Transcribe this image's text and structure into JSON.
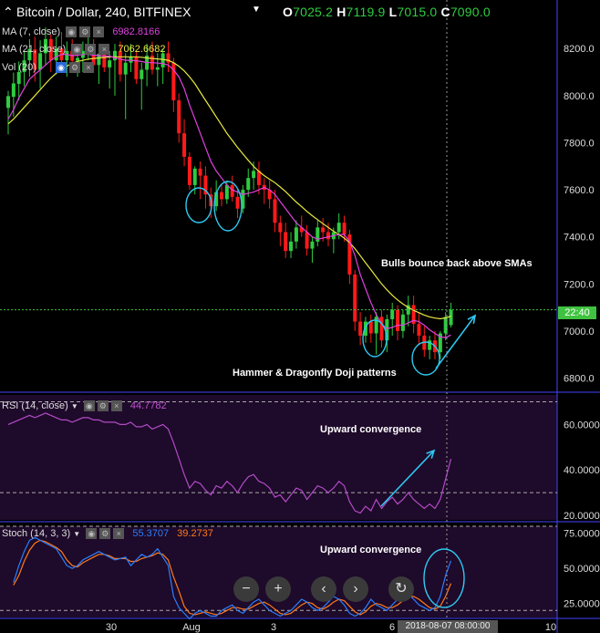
{
  "header": {
    "symbol": "Bitcoin / Dollar, 240, BITFINEX",
    "o_label": "O",
    "o": "7025.2",
    "h_label": "H",
    "h": "7119.9",
    "l_label": "L",
    "l": "7015.0",
    "c_label": "C",
    "c": "7090.0"
  },
  "legends": {
    "ma7_label": "MA (7, close)",
    "ma7_value": "6982.8166",
    "ma21_label": "MA (21, close)",
    "ma21_value": "7062.6682",
    "vol_label": "Vol (20)",
    "rsi_label": "RSI (14, close)",
    "rsi_value": "44.7782",
    "stoch_label": "Stoch (14, 3, 3)",
    "stoch_k": "55.3707",
    "stoch_d": "39.2737"
  },
  "annotations": {
    "bulls": "Bulls bounce back above SMAs",
    "patterns": "Hammer & Dragonfly Doji patterns",
    "rsi_conv": "Upward convergence",
    "stoch_conv": "Upward convergence"
  },
  "price_tag": "22:40",
  "crosshair_label": "2018-08-07 08:00:00",
  "colors": {
    "bull": "#2ecc40",
    "bear": "#ff1a1a",
    "ma7": "#e040e0",
    "ma21": "#e8e840",
    "rsi": "#b34bc8",
    "stoch_k": "#2a7fff",
    "stoch_d": "#ff7a1a",
    "arrow": "#2ec8f0",
    "panel": "#1e0a2a"
  },
  "chart_data": [
    {
      "type": "candlestick",
      "title": "Bitcoin / Dollar, 240, BITFINEX",
      "xlabel": "",
      "ylabel": "",
      "ylim": [
        6740,
        8290
      ],
      "y_ticks": [
        6800,
        7000,
        7200,
        7400,
        7600,
        7800,
        8000,
        8200
      ],
      "x_ticks": [
        "30",
        "Aug",
        "3",
        "6",
        "10"
      ],
      "candles": [
        [
          7948,
          8020,
          7835,
          7998
        ],
        [
          7995,
          8098,
          7910,
          8052
        ],
        [
          8050,
          8145,
          7980,
          8100
        ],
        [
          8100,
          8190,
          8040,
          8150
        ],
        [
          8150,
          8240,
          8080,
          8198
        ],
        [
          8196,
          8250,
          8060,
          8110
        ],
        [
          8110,
          8235,
          8030,
          8180
        ],
        [
          8180,
          8290,
          8130,
          8240
        ],
        [
          8240,
          8260,
          8100,
          8150
        ],
        [
          8150,
          8250,
          8090,
          8200
        ],
        [
          8200,
          8270,
          8120,
          8150
        ],
        [
          8150,
          8230,
          8080,
          8190
        ],
        [
          8190,
          8240,
          8120,
          8148
        ],
        [
          8148,
          8200,
          8080,
          8160
        ],
        [
          8160,
          8230,
          8100,
          8190
        ],
        [
          8190,
          8270,
          8150,
          8214
        ],
        [
          8214,
          8240,
          8100,
          8130
        ],
        [
          8130,
          8200,
          8050,
          8178
        ],
        [
          8178,
          8220,
          8100,
          8120
        ],
        [
          8120,
          8190,
          8030,
          8150
        ],
        [
          8150,
          8220,
          8000,
          8190
        ],
        [
          8190,
          8230,
          8060,
          8090
        ],
        [
          8090,
          8180,
          7900,
          8140
        ],
        [
          8140,
          8220,
          8100,
          8165
        ],
        [
          8165,
          8190,
          8050,
          8070
        ],
        [
          8070,
          8140,
          7940,
          8110
        ],
        [
          8110,
          8220,
          8040,
          8170
        ],
        [
          8170,
          8230,
          8090,
          8110
        ],
        [
          8110,
          8180,
          8040,
          8120
        ],
        [
          8120,
          8200,
          8050,
          8180
        ],
        [
          8180,
          8230,
          8100,
          8140
        ],
        [
          8140,
          8160,
          7930,
          7980
        ],
        [
          7980,
          8010,
          7800,
          7840
        ],
        [
          7840,
          7900,
          7700,
          7740
        ],
        [
          7740,
          7760,
          7600,
          7620
        ],
        [
          7620,
          7700,
          7580,
          7690
        ],
        [
          7690,
          7720,
          7560,
          7660
        ],
        [
          7660,
          7700,
          7520,
          7580
        ],
        [
          7580,
          7610,
          7480,
          7530
        ],
        [
          7530,
          7640,
          7510,
          7590
        ],
        [
          7590,
          7620,
          7530,
          7560
        ],
        [
          7560,
          7640,
          7540,
          7620
        ],
        [
          7620,
          7660,
          7550,
          7570
        ],
        [
          7570,
          7600,
          7480,
          7520
        ],
        [
          7520,
          7620,
          7500,
          7600
        ],
        [
          7600,
          7690,
          7570,
          7650
        ],
        [
          7650,
          7720,
          7600,
          7680
        ],
        [
          7680,
          7720,
          7580,
          7620
        ],
        [
          7620,
          7650,
          7540,
          7600
        ],
        [
          7600,
          7640,
          7520,
          7560
        ],
        [
          7560,
          7600,
          7420,
          7460
        ],
        [
          7460,
          7490,
          7360,
          7420
        ],
        [
          7420,
          7460,
          7310,
          7340
        ],
        [
          7340,
          7420,
          7310,
          7380
        ],
        [
          7380,
          7470,
          7350,
          7440
        ],
        [
          7440,
          7490,
          7400,
          7420
        ],
        [
          7420,
          7450,
          7320,
          7350
        ],
        [
          7350,
          7400,
          7290,
          7380
        ],
        [
          7380,
          7470,
          7360,
          7440
        ],
        [
          7440,
          7480,
          7380,
          7420
        ],
        [
          7420,
          7460,
          7360,
          7390
        ],
        [
          7390,
          7440,
          7330,
          7420
        ],
        [
          7420,
          7500,
          7390,
          7460
        ],
        [
          7460,
          7490,
          7380,
          7410
        ],
        [
          7410,
          7430,
          7200,
          7240
        ],
        [
          7240,
          7260,
          7000,
          7040
        ],
        [
          7040,
          7080,
          6940,
          6980
        ],
        [
          6980,
          7060,
          6950,
          7040
        ],
        [
          7040,
          7070,
          6950,
          6990
        ],
        [
          6990,
          7080,
          6900,
          7060
        ],
        [
          7060,
          7090,
          6930,
          6960
        ],
        [
          6960,
          7070,
          6910,
          7050
        ],
        [
          7050,
          7120,
          6980,
          7090
        ],
        [
          7090,
          7110,
          6960,
          7000
        ],
        [
          7000,
          7090,
          6970,
          7070
        ],
        [
          7070,
          7150,
          7020,
          7110
        ],
        [
          7110,
          7150,
          6990,
          7030
        ],
        [
          7030,
          7080,
          6940,
          6980
        ],
        [
          6980,
          7020,
          6890,
          6920
        ],
        [
          6920,
          6980,
          6880,
          6960
        ],
        [
          6960,
          7000,
          6880,
          6910
        ],
        [
          6910,
          7000,
          6880,
          6990
        ],
        [
          6990,
          7080,
          6960,
          7060
        ],
        [
          7025.2,
          7119.9,
          7015,
          7090
        ]
      ],
      "ma7": [
        7900,
        7940,
        7990,
        8030,
        8070,
        8090,
        8110,
        8130,
        8150,
        8165,
        8175,
        8175,
        8170,
        8172,
        8175,
        8175,
        8172,
        8170,
        8168,
        8168,
        8160,
        8155,
        8150,
        8150,
        8148,
        8145,
        8140,
        8140,
        8138,
        8136,
        8130,
        8110,
        8080,
        8030,
        7960,
        7900,
        7840,
        7780,
        7720,
        7680,
        7650,
        7620,
        7600,
        7590,
        7580,
        7585,
        7590,
        7600,
        7610,
        7600,
        7580,
        7550,
        7520,
        7490,
        7460,
        7440,
        7420,
        7400,
        7390,
        7395,
        7400,
        7405,
        7410,
        7410,
        7380,
        7320,
        7240,
        7180,
        7120,
        7070,
        7030,
        7010,
        7015,
        7025,
        7025,
        7035,
        7045,
        7040,
        7025,
        7005,
        6990,
        6975,
        6972,
        6982.8
      ],
      "ma21": [
        7880,
        7900,
        7925,
        7950,
        7975,
        8000,
        8025,
        8050,
        8075,
        8095,
        8110,
        8125,
        8138,
        8145,
        8150,
        8155,
        8158,
        8160,
        8162,
        8164,
        8165,
        8165,
        8165,
        8165,
        8165,
        8163,
        8160,
        8158,
        8156,
        8154,
        8150,
        8140,
        8125,
        8105,
        8080,
        8050,
        8015,
        7980,
        7945,
        7910,
        7875,
        7840,
        7810,
        7780,
        7752,
        7725,
        7700,
        7678,
        7660,
        7645,
        7630,
        7612,
        7592,
        7570,
        7548,
        7528,
        7508,
        7490,
        7473,
        7456,
        7440,
        7424,
        7410,
        7395,
        7375,
        7350,
        7320,
        7290,
        7260,
        7230,
        7200,
        7175,
        7152,
        7132,
        7115,
        7100,
        7088,
        7078,
        7068,
        7060,
        7055,
        7052,
        7056,
        7062.7
      ]
    },
    {
      "type": "line",
      "title": "RSI (14, close)",
      "ylim": [
        18,
        73
      ],
      "y_ticks": [
        20,
        40,
        60
      ],
      "series": [
        {
          "name": "RSI (14, close)",
          "values": [
            60,
            61,
            62,
            63,
            64,
            63,
            64,
            65,
            64,
            63,
            62,
            62,
            61,
            62,
            63,
            63,
            62,
            62,
            61,
            61,
            61,
            60,
            60,
            61,
            59,
            59,
            60,
            58,
            59,
            60,
            58,
            52,
            45,
            38,
            32,
            35,
            34,
            31,
            29,
            33,
            32,
            35,
            33,
            30,
            34,
            37,
            38,
            35,
            34,
            32,
            28,
            29,
            26,
            29,
            32,
            31,
            27,
            30,
            33,
            32,
            30,
            32,
            35,
            33,
            26,
            22,
            21,
            24,
            22,
            27,
            23,
            26,
            28,
            25,
            27,
            30,
            27,
            25,
            23,
            25,
            23,
            27,
            36,
            44.8
          ]
        }
      ]
    },
    {
      "type": "line",
      "title": "Stoch (14, 3, 3)",
      "ylim": [
        15,
        80
      ],
      "y_ticks": [
        25,
        50,
        75
      ],
      "series": [
        {
          "name": "K",
          "values": [
            40,
            52,
            62,
            70,
            72,
            70,
            68,
            66,
            64,
            58,
            52,
            50,
            52,
            56,
            58,
            60,
            62,
            60,
            58,
            56,
            57,
            58,
            52,
            56,
            60,
            58,
            60,
            64,
            58,
            52,
            30,
            22,
            18,
            14,
            18,
            20,
            18,
            16,
            16,
            20,
            22,
            24,
            20,
            18,
            22,
            26,
            28,
            24,
            20,
            18,
            16,
            18,
            20,
            24,
            28,
            26,
            22,
            20,
            22,
            26,
            30,
            28,
            24,
            18,
            16,
            18,
            22,
            28,
            24,
            22,
            20,
            24,
            28,
            30,
            32,
            28,
            24,
            22,
            20,
            22,
            30,
            45,
            55.4
          ]
        },
        {
          "name": "D",
          "values": [
            38,
            45,
            55,
            63,
            68,
            70,
            69,
            67,
            65,
            62,
            56,
            52,
            51,
            54,
            56,
            58,
            60,
            60,
            59,
            57,
            57,
            57,
            55,
            55,
            57,
            58,
            59,
            61,
            60,
            56,
            44,
            34,
            23,
            18,
            17,
            18,
            19,
            18,
            17,
            18,
            20,
            22,
            22,
            21,
            21,
            23,
            25,
            26,
            24,
            21,
            18,
            17,
            18,
            21,
            24,
            26,
            25,
            22,
            21,
            23,
            26,
            28,
            27,
            23,
            19,
            17,
            19,
            23,
            25,
            24,
            22,
            22,
            24,
            27,
            30,
            30,
            28,
            25,
            22,
            21,
            23,
            30,
            39.3
          ]
        }
      ]
    }
  ]
}
